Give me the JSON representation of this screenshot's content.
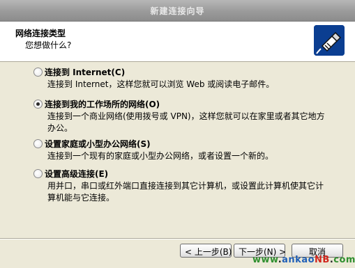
{
  "window": {
    "title": "新建连接向导"
  },
  "header": {
    "title": "网络连接类型",
    "subtitle": "您想做什么?"
  },
  "options": [
    {
      "label": "连接到 Internet(C)",
      "description": "连接到 Internet，这样您就可以浏览 Web 或阅读电子邮件。",
      "selected": false
    },
    {
      "label": "连接到我的工作场所的网络(O)",
      "description": "连接到一个商业网络(使用拨号或 VPN)，这样您就可以在家里或者其它地方办公。",
      "selected": true
    },
    {
      "label": "设置家庭或小型办公网络(S)",
      "description": "连接到一个现有的家庭或小型办公网络，或者设置一个新的。",
      "selected": false
    },
    {
      "label": "设置高级连接(E)",
      "description": "用并口，串口或红外端口直接连接到其它计算机，或设置此计算机使其它计算机能与它连接。",
      "selected": false
    }
  ],
  "buttons": {
    "back": "< 上一步(B)",
    "next": "下一步(N) >",
    "cancel": "取消"
  },
  "watermark": {
    "www": "www",
    "dot1": ".",
    "ankao": "ankao",
    "nb": "NB",
    "dot2": ".",
    "com": "com"
  }
}
